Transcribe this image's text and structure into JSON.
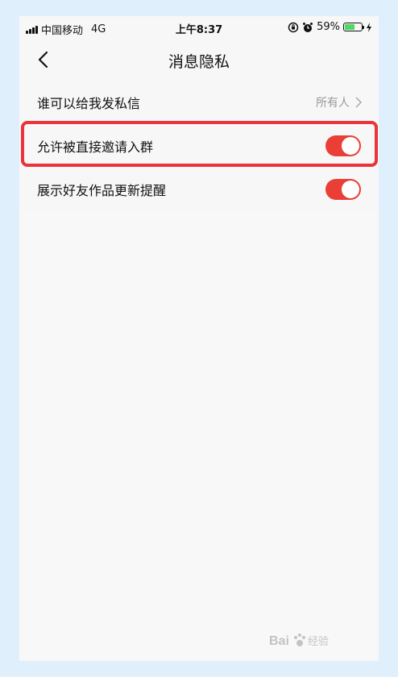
{
  "status_bar": {
    "carrier": "中国移动",
    "network": "4G",
    "time": "上午8:37",
    "battery_percent": "59%",
    "battery_level": 0.59,
    "icons": [
      "signal-icon",
      "rotation-lock-icon",
      "alarm-icon",
      "battery-icon",
      "charging-icon"
    ]
  },
  "nav": {
    "title": "消息隐私",
    "back_icon": "chevron-left-icon"
  },
  "settings": {
    "items": [
      {
        "label": "谁可以给我发私信",
        "value": "所有人",
        "type": "link"
      },
      {
        "label": "允许被直接邀请入群",
        "type": "toggle",
        "on": true,
        "highlighted": true
      },
      {
        "label": "展示好友作品更新提醒",
        "type": "toggle",
        "on": true
      }
    ]
  },
  "colors": {
    "accent": "#ea3f36",
    "highlight": "#e8343b",
    "background": "#f8f8f8",
    "outer_background": "#dff0fc"
  },
  "watermark": {
    "text": "Bai 经验",
    "icon": "baidu-paw-icon"
  }
}
